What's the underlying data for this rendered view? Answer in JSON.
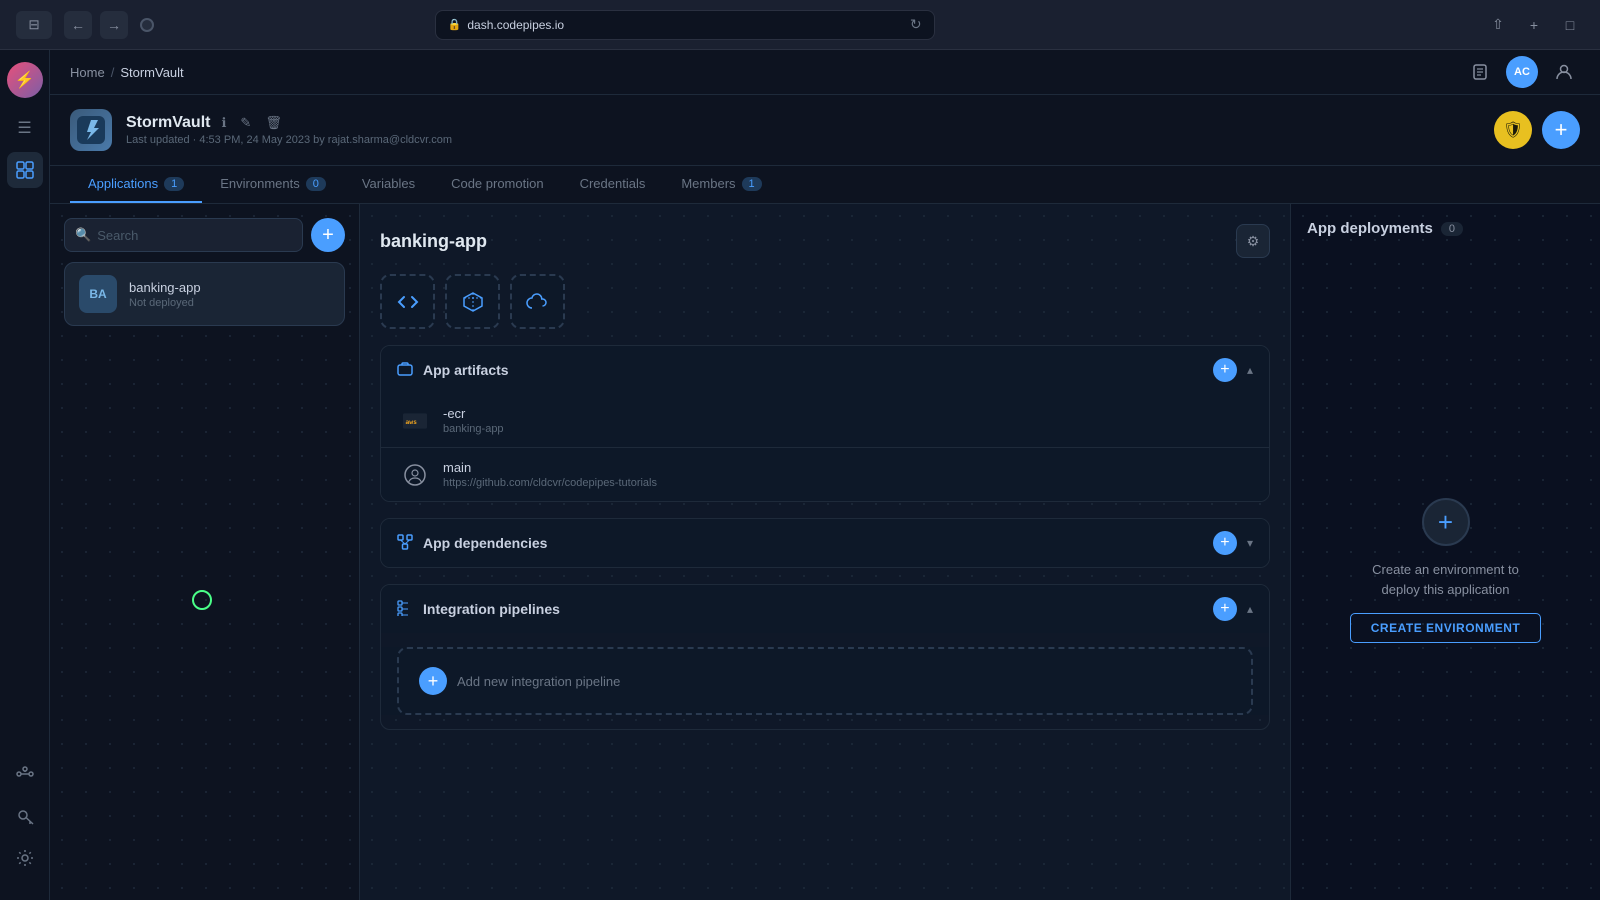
{
  "browser": {
    "url": "dash.codepipes.io",
    "tabs": [
      "StormVault"
    ]
  },
  "topbar": {
    "breadcrumb_home": "Home",
    "breadcrumb_sep": "/",
    "breadcrumb_current": "StormVault",
    "avatar_initials": "AC"
  },
  "project": {
    "name": "StormVault",
    "last_updated": "Last updated · 4:53 PM, 24 May 2023 by rajat.sharma@cldcvr.com",
    "logo_icon": "⛈"
  },
  "tabs": [
    {
      "id": "applications",
      "label": "Applications",
      "badge": "1",
      "active": true
    },
    {
      "id": "environments",
      "label": "Environments",
      "badge": "0",
      "active": false
    },
    {
      "id": "variables",
      "label": "Variables",
      "badge": "",
      "active": false
    },
    {
      "id": "code_promotion",
      "label": "Code promotion",
      "badge": "",
      "active": false
    },
    {
      "id": "credentials",
      "label": "Credentials",
      "badge": "",
      "active": false
    },
    {
      "id": "members",
      "label": "Members",
      "badge": "1",
      "active": false
    }
  ],
  "app_list": {
    "search_placeholder": "Search",
    "apps": [
      {
        "id": "banking-app",
        "initials": "BA",
        "name": "banking-app",
        "status": "Not deployed"
      }
    ]
  },
  "app_detail": {
    "title": "banking-app",
    "sections": {
      "artifacts": {
        "title": "App artifacts",
        "items": [
          {
            "type": "ecr",
            "name": "-ecr",
            "sub": "banking-app"
          },
          {
            "type": "github",
            "name": "main",
            "sub": "https://github.com/cldcvr/codepipes-tutorials"
          }
        ]
      },
      "dependencies": {
        "title": "App dependencies"
      },
      "pipelines": {
        "title": "Integration pipelines",
        "add_label": "Add new integration pipeline"
      }
    }
  },
  "deployments": {
    "title": "App deployments",
    "count": "0",
    "empty_text": "Create an environment to deploy this application",
    "cta_label": "CREATE ENVIRONMENT"
  },
  "icons": {
    "search": "🔍",
    "settings": "⚙",
    "shield": "🛡",
    "plus": "+",
    "chevron_down": "▾",
    "chevron_up": "▴",
    "info": "ℹ",
    "edit": "✎",
    "delete": "🗑",
    "hamburger": "☰",
    "back": "←",
    "forward": "→",
    "refresh": "↻",
    "share": "↑",
    "newtab": "+",
    "sidebar": "⊞",
    "diamond": "◆",
    "code_icon": "</>",
    "box_icon": "⬡",
    "cloud_icon": "☁",
    "aws_icon": "aws",
    "github_icon": "⊙",
    "gear_icon": "⚙",
    "key_icon": "🔑",
    "user_icon": "👤",
    "pipeline_icon": "⊞"
  }
}
